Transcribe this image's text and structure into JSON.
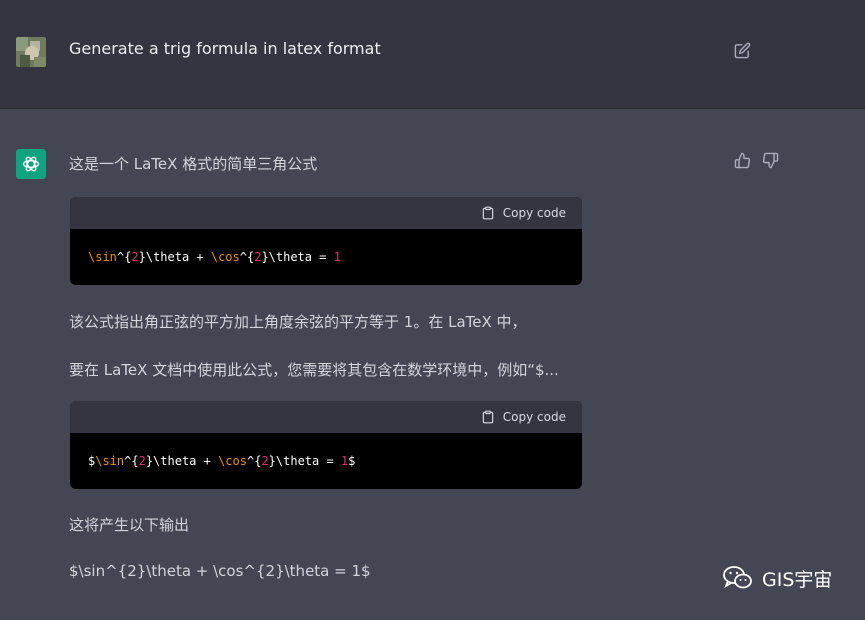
{
  "user_message": {
    "text": "Generate a trig formula in latex format"
  },
  "assistant": {
    "intro": "这是一个 LaTeX 格式的简单三角公式",
    "code1": {
      "copy_label": "Copy code",
      "tokens": [
        "\\sin",
        "^{",
        "2",
        "}\\theta + ",
        "\\cos",
        "^{",
        "2",
        "}\\theta = ",
        "1"
      ]
    },
    "para1": "该公式指出角正弦的平方加上角度余弦的平方等于 1。在 LaTeX 中，",
    "para2": "要在 LaTeX 文档中使用此公式，您需要将其包含在数学环境中，例如“$...",
    "code2": {
      "copy_label": "Copy code",
      "tokens": [
        "$",
        "\\sin",
        "^{",
        "2",
        "}\\theta + ",
        "\\cos",
        "^{",
        "2",
        "}\\theta = ",
        "1",
        "$"
      ]
    },
    "para3": "这将产生以下输出",
    "para4": "$\\sin^{2}\\theta + \\cos^{2}\\theta = 1$"
  },
  "watermark": {
    "text": "GIS宇宙"
  },
  "icons": [
    "edit-icon",
    "thumbs-up-icon",
    "thumbs-down-icon",
    "clipboard-icon",
    "chatgpt-logo-icon",
    "wechat-icon"
  ]
}
